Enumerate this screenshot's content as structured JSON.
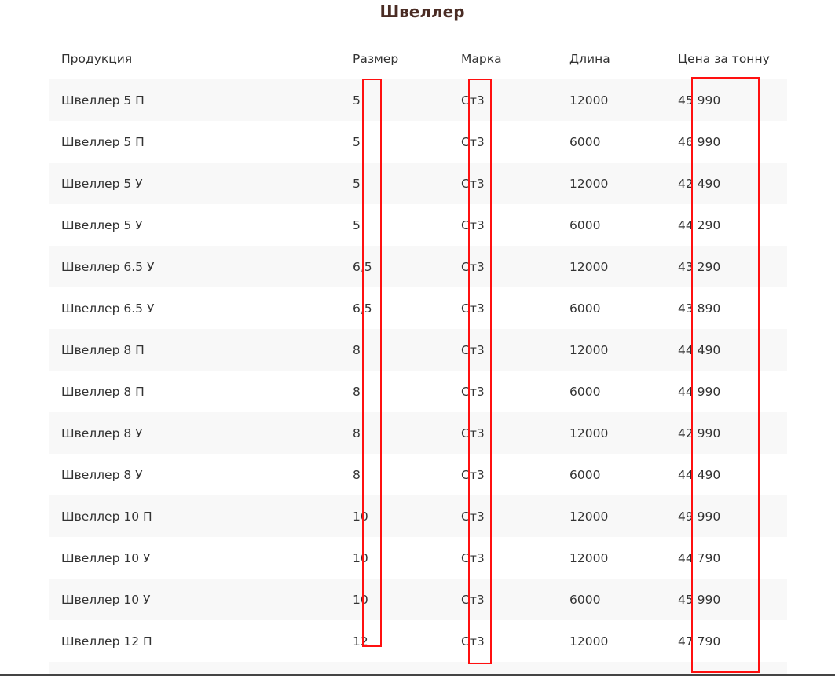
{
  "section": {
    "title": "Швеллер"
  },
  "table": {
    "headers": [
      "Продукция",
      "Размер",
      "Марка",
      "Длина",
      "Цена за тонну"
    ],
    "rows": [
      [
        "Швеллер 5 П",
        "5",
        "Ст3",
        "12000",
        "45 990"
      ],
      [
        "Швеллер 5 П",
        "5",
        "Ст3",
        "6000",
        "46 990"
      ],
      [
        "Швеллер 5 У",
        "5",
        "Ст3",
        "12000",
        "42 490"
      ],
      [
        "Швеллер 5 У",
        "5",
        "Ст3",
        "6000",
        "44 290"
      ],
      [
        "Швеллер 6.5 У",
        "6,5",
        "Ст3",
        "12000",
        "43 290"
      ],
      [
        "Швеллер 6.5 У",
        "6,5",
        "Ст3",
        "6000",
        "43 890"
      ],
      [
        "Швеллер 8 П",
        "8",
        "Ст3",
        "12000",
        "44 490"
      ],
      [
        "Швеллер 8 П",
        "8",
        "Ст3",
        "6000",
        "44 990"
      ],
      [
        "Швеллер 8 У",
        "8",
        "Ст3",
        "12000",
        "42 990"
      ],
      [
        "Швеллер 8 У",
        "8",
        "Ст3",
        "6000",
        "44 490"
      ],
      [
        "Швеллер 10 П",
        "10",
        "Ст3",
        "12000",
        "49 990"
      ],
      [
        "Швеллер 10 У",
        "10",
        "Ст3",
        "12000",
        "44 790"
      ],
      [
        "Швеллер 10 У",
        "10",
        "Ст3",
        "6000",
        "45 990"
      ],
      [
        "Швеллер 12 П",
        "12",
        "Ст3",
        "12000",
        "47 790"
      ],
      [
        "",
        "",
        "",
        "",
        ""
      ]
    ]
  },
  "highlight_columns": [
    "Размер",
    "Марка",
    "Цена за тонну"
  ],
  "colors": {
    "title": "#4a2c24",
    "text": "#333333",
    "row_stripe": "#f8f8f8",
    "highlight_box": "#ff1010"
  }
}
